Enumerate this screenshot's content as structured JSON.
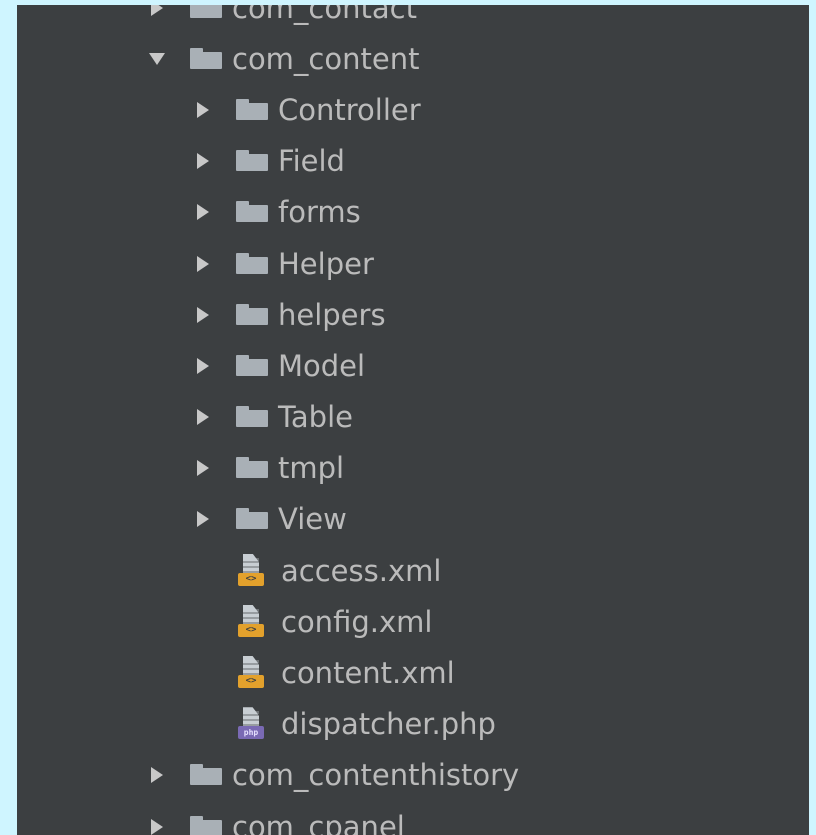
{
  "tree": {
    "items": [
      {
        "label": "com_contact"
      },
      {
        "label": "com_content"
      },
      {
        "label": "Controller"
      },
      {
        "label": "Field"
      },
      {
        "label": "forms"
      },
      {
        "label": "Helper"
      },
      {
        "label": "helpers"
      },
      {
        "label": "Model"
      },
      {
        "label": "Table"
      },
      {
        "label": "tmpl"
      },
      {
        "label": "View"
      },
      {
        "label": "access.xml",
        "badge": "<>"
      },
      {
        "label": "config.xml",
        "badge": "<>"
      },
      {
        "label": "content.xml",
        "badge": "<>"
      },
      {
        "label": "dispatcher.php",
        "badge": "php"
      },
      {
        "label": "com_contenthistory"
      },
      {
        "label": "com_cpanel"
      }
    ]
  },
  "colors": {
    "outer_background": "#cff5ff",
    "panel_background": "#3c3f41",
    "text": "#bbbbbb",
    "folder": "#a9b0b6",
    "xml_badge": "#e3a12c",
    "php_badge": "#7a6ab4"
  }
}
